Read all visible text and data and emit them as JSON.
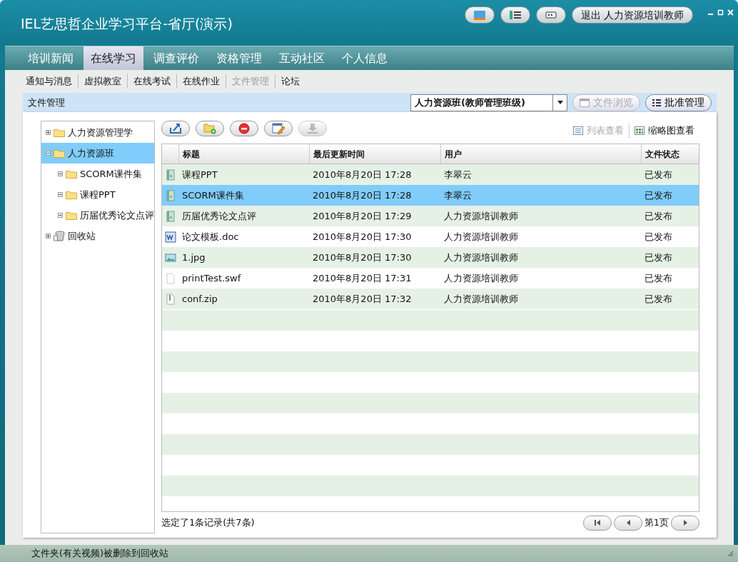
{
  "window": {
    "title": "IEL艺思哲企业学习平台-省厅(演示)"
  },
  "top_buttons": [
    {
      "kind": "logo"
    },
    {
      "kind": "list"
    },
    {
      "kind": "card"
    }
  ],
  "logout_button": "退出 人力资源培训教师",
  "nav_tabs": [
    {
      "label": "培训新闻",
      "selected": false
    },
    {
      "label": "在线学习",
      "selected": true
    },
    {
      "label": "调查评价",
      "selected": false
    },
    {
      "label": "资格管理",
      "selected": false
    },
    {
      "label": "互动社区",
      "selected": false
    },
    {
      "label": "个人信息",
      "selected": false
    }
  ],
  "sub_nav": [
    {
      "label": "通知与消息",
      "selected": false
    },
    {
      "label": "虚拟教室",
      "selected": false
    },
    {
      "label": "在线考试",
      "selected": false
    },
    {
      "label": "在线作业",
      "selected": false
    },
    {
      "label": "文件管理",
      "selected": true
    },
    {
      "label": "论坛",
      "selected": false
    }
  ],
  "header": {
    "title": "文件管理",
    "class_select": "人力资源班(教师管理班级)",
    "buttons": [
      {
        "kind": "browse",
        "label": "文件浏览",
        "disabled": true
      },
      {
        "kind": "approve",
        "label": "批准管理",
        "disabled": false
      }
    ]
  },
  "tree": [
    {
      "label": "人力资源管理学",
      "kind": "folder",
      "expanded": false,
      "selected": false
    },
    {
      "label": "人力资源班",
      "kind": "folder",
      "expanded": true,
      "selected": true,
      "children": [
        {
          "label": "SCORM课件集",
          "kind": "folder",
          "expanded": true,
          "selected": false
        },
        {
          "label": "课程PPT",
          "kind": "folder",
          "expanded": true,
          "selected": false
        },
        {
          "label": "历届优秀论文点评",
          "kind": "folder",
          "expanded": true,
          "selected": false
        }
      ]
    },
    {
      "label": "回收站",
      "kind": "recycle",
      "expanded": false,
      "selected": false
    }
  ],
  "toolbar": [
    {
      "kind": "upload",
      "disabled": false
    },
    {
      "kind": "new-folder",
      "disabled": false
    },
    {
      "kind": "delete",
      "disabled": false
    },
    {
      "kind": "edit",
      "disabled": false
    },
    {
      "kind": "download",
      "disabled": true
    }
  ],
  "view_modes": [
    {
      "kind": "list",
      "label": "列表查看",
      "selected": true
    },
    {
      "kind": "thumbnail",
      "label": "缩略图查看",
      "selected": false
    }
  ],
  "table": {
    "columns": [
      "标题",
      "最后更新时间",
      "用户",
      "文件状态"
    ],
    "rows": [
      {
        "kind": "book",
        "title": "课程PPT",
        "time": "2010年8月20日 17:28",
        "user": "李翠云",
        "status": "已发布",
        "selected": false
      },
      {
        "kind": "book",
        "title": "SCORM课件集",
        "time": "2010年8月20日 17:28",
        "user": "李翠云",
        "status": "已发布",
        "selected": true
      },
      {
        "kind": "book",
        "title": "历届优秀论文点评",
        "time": "2010年8月20日 17:29",
        "user": "人力资源培训教师",
        "status": "已发布",
        "selected": false
      },
      {
        "kind": "doc",
        "title": "论文模板.doc",
        "time": "2010年8月20日 17:30",
        "user": "人力资源培训教师",
        "status": "已发布",
        "selected": false
      },
      {
        "kind": "image",
        "title": "1.jpg",
        "time": "2010年8月20日 17:30",
        "user": "人力资源培训教师",
        "status": "已发布",
        "selected": false
      },
      {
        "kind": "file",
        "title": "printTest.swf",
        "time": "2010年8月20日 17:31",
        "user": "人力资源培训教师",
        "status": "已发布",
        "selected": false
      },
      {
        "kind": "zip",
        "title": "conf.zip",
        "time": "2010年8月20日 17:32",
        "user": "人力资源培训教师",
        "status": "已发布",
        "selected": false
      }
    ]
  },
  "footer": {
    "selection": "选定了1条记录(共7条)",
    "page": "第1页"
  },
  "status_bar": "文件夹(有关视频)被删除到回收站"
}
